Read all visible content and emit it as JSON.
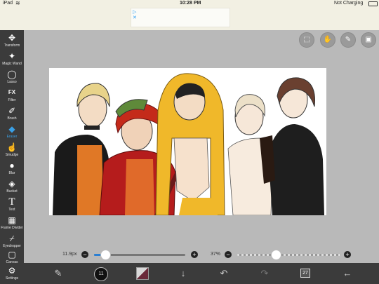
{
  "status_bar": {
    "device": "iPad",
    "time": "10:28 PM",
    "battery": "Not Charging"
  },
  "toolbar": {
    "tools": [
      {
        "label": "Transform",
        "icon": "move-icon"
      },
      {
        "label": "Magic Wand",
        "icon": "magic-wand-icon"
      },
      {
        "label": "Lasso",
        "icon": "lasso-icon"
      },
      {
        "label": "Filter",
        "icon": "filter-icon"
      },
      {
        "label": "Brush",
        "icon": "brush-icon"
      },
      {
        "label": "Eraser",
        "icon": "eraser-icon",
        "active": true
      },
      {
        "label": "Smudge",
        "icon": "smudge-icon"
      },
      {
        "label": "Blur",
        "icon": "blur-icon"
      },
      {
        "label": "Bucket",
        "icon": "bucket-icon"
      },
      {
        "label": "Text",
        "icon": "text-icon"
      },
      {
        "label": "Frame Divider",
        "icon": "frame-divider-icon"
      },
      {
        "label": "Eyedropper",
        "icon": "eyedropper-icon"
      },
      {
        "label": "Canvas",
        "icon": "canvas-icon"
      },
      {
        "label": "Settings",
        "icon": "gear-icon"
      }
    ]
  },
  "top_actions": [
    "selection-icon",
    "hand-icon",
    "pen-icon",
    "image-icon"
  ],
  "sliders": {
    "size_label": "11.9px",
    "size_level": 0.12,
    "opacity_label": "37%",
    "opacity_level": 0.37
  },
  "bottom_bar": {
    "layers_count": "27",
    "brush_badge": "11"
  },
  "accent": "#2a7fd4"
}
